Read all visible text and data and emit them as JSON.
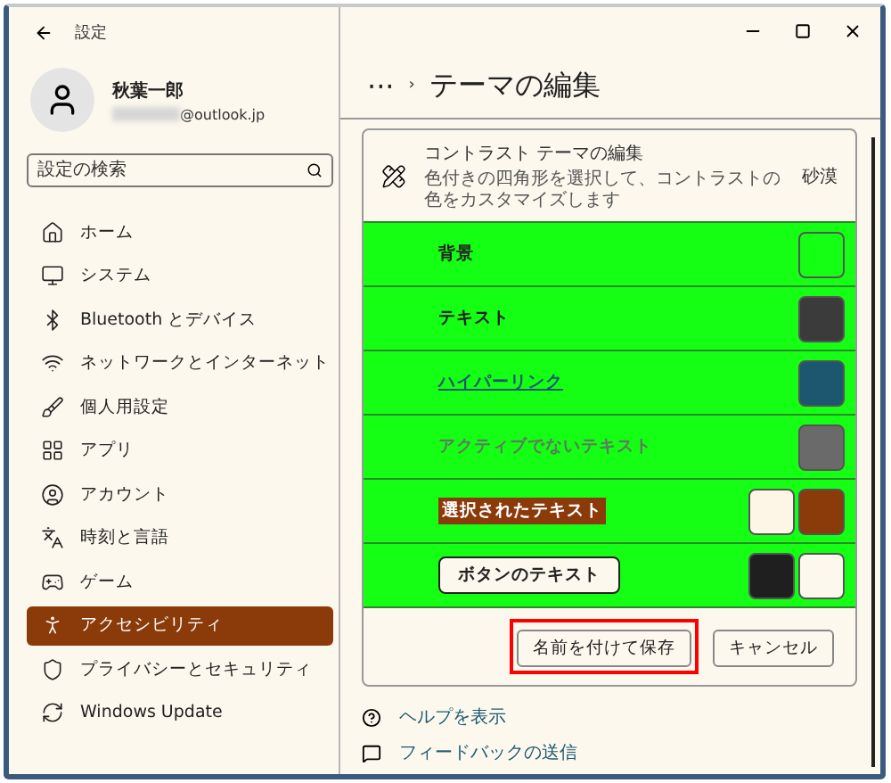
{
  "window": {
    "title": "設定"
  },
  "profile": {
    "name": "秋葉一郎",
    "email": "@outlook.jp"
  },
  "search": {
    "placeholder": "設定の検索"
  },
  "sidebar": {
    "items": [
      {
        "label": "ホーム",
        "selected": false
      },
      {
        "label": "システム",
        "selected": false
      },
      {
        "label": "Bluetooth とデバイス",
        "selected": false
      },
      {
        "label": "ネットワークとインターネット",
        "selected": false
      },
      {
        "label": "個人用設定",
        "selected": false
      },
      {
        "label": "アプリ",
        "selected": false
      },
      {
        "label": "アカウント",
        "selected": false
      },
      {
        "label": "時刻と言語",
        "selected": false
      },
      {
        "label": "ゲーム",
        "selected": false
      },
      {
        "label": "アクセシビリティ",
        "selected": true
      },
      {
        "label": "プライバシーとセキュリティ",
        "selected": false
      },
      {
        "label": "Windows Update",
        "selected": false
      }
    ]
  },
  "breadcrumb": {
    "more": "···",
    "separator": "›",
    "title": "テーマの編集"
  },
  "card": {
    "title": "コントラスト テーマの編集",
    "subtitle": "色付きの四角形を選択して、コントラストの色をカスタマイズします",
    "theme": "砂漠",
    "rows": [
      {
        "label": "背景",
        "kind": "text",
        "swatches": [
          {
            "color": "#14ff14"
          }
        ]
      },
      {
        "label": "テキスト",
        "kind": "text",
        "swatches": [
          {
            "color": "#3b3b3b"
          }
        ]
      },
      {
        "label": "ハイパーリンク",
        "kind": "link",
        "swatches": [
          {
            "color": "#1b5870"
          }
        ]
      },
      {
        "label": "アクティブでないテキスト",
        "kind": "inactive",
        "swatches": [
          {
            "color": "#6a6a6a"
          }
        ]
      },
      {
        "label": "選択されたテキスト",
        "kind": "selected",
        "swatches": [
          {
            "color": "#fdf6e6"
          },
          {
            "color": "#8b3a0a"
          }
        ]
      },
      {
        "label": "ボタンのテキスト",
        "kind": "button",
        "swatches": [
          {
            "color": "#1f1f1f"
          },
          {
            "color": "#fdf8ee"
          }
        ]
      }
    ],
    "buttons": [
      {
        "label": "名前を付けて保存",
        "highlighted": true
      },
      {
        "label": "キャンセル",
        "highlighted": false
      }
    ]
  },
  "links": [
    {
      "label": "ヘルプを表示"
    },
    {
      "label": "フィードバックの送信"
    }
  ]
}
